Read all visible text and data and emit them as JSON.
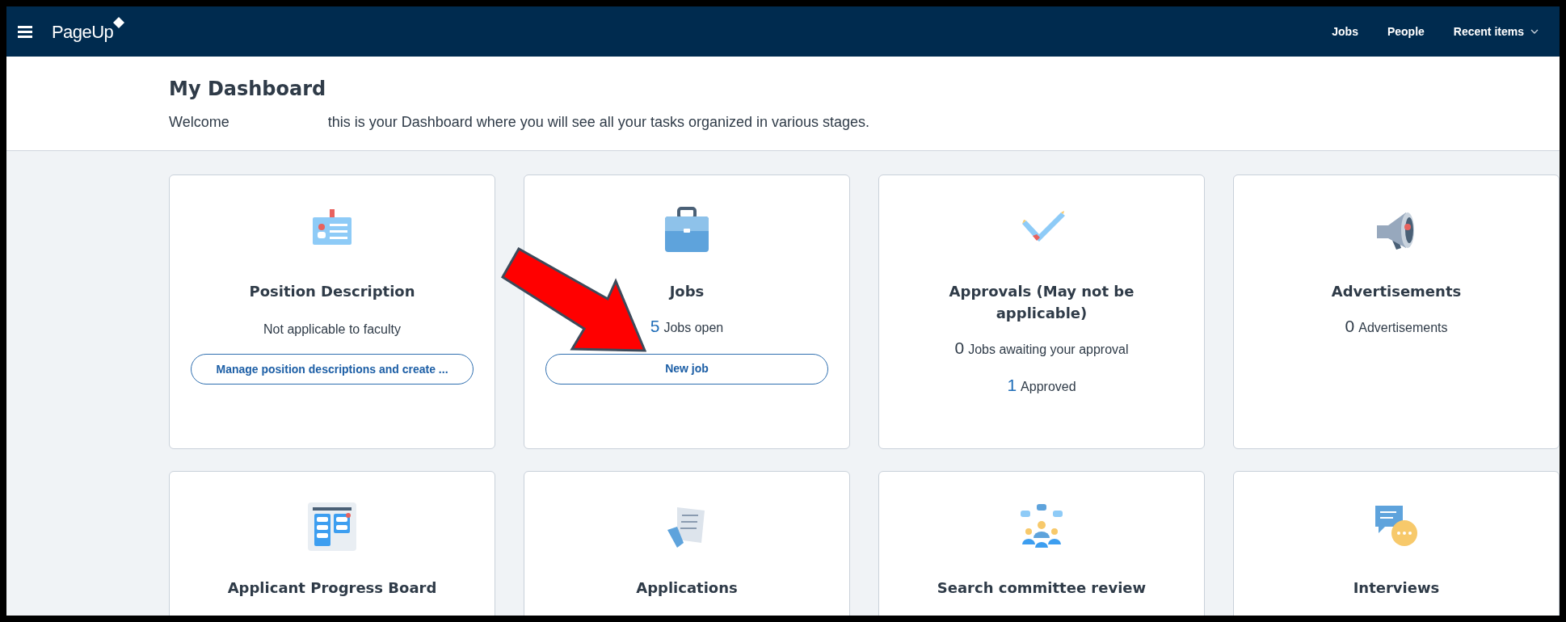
{
  "header": {
    "logo": "PageUp",
    "nav": [
      {
        "label": "Jobs",
        "dropdown": false
      },
      {
        "label": "People",
        "dropdown": false
      },
      {
        "label": "Recent items",
        "dropdown": true
      }
    ]
  },
  "page": {
    "title": "My Dashboard",
    "welcome_start": "Welcome",
    "welcome_rest": "this is your Dashboard where you will see all your tasks organized in various stages."
  },
  "cards": [
    {
      "title": "Position Description",
      "note": "Not applicable to faculty",
      "button": "Manage position descriptions and create ..."
    },
    {
      "title": "Jobs",
      "stats": [
        {
          "count": "5",
          "label": "Jobs open",
          "highlighted": true
        }
      ],
      "button": "New job"
    },
    {
      "title": "Approvals (May not be applicable)",
      "stats": [
        {
          "count": "0",
          "label": "Jobs awaiting your approval",
          "highlighted": false
        },
        {
          "count": "1",
          "label": "Approved",
          "highlighted": true
        }
      ]
    },
    {
      "title": "Advertisements",
      "stats": [
        {
          "count": "0",
          "label": "Advertisements",
          "highlighted": false
        }
      ]
    },
    {
      "title": "Applicant Progress Board"
    },
    {
      "title": "Applications"
    },
    {
      "title": "Search committee review"
    },
    {
      "title": "Interviews"
    }
  ]
}
